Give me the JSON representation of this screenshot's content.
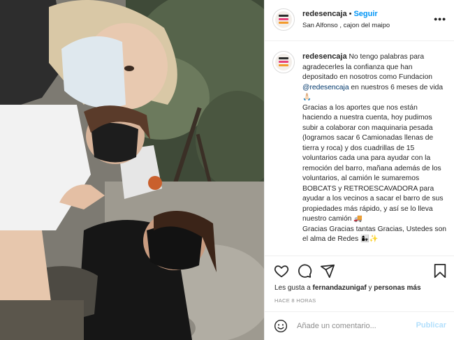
{
  "post": {
    "image_alt": "Three women wearing face masks in a forest",
    "image_icon": "photo-image"
  },
  "header": {
    "username": "redesencaja",
    "separator": "•",
    "follow_label": "Seguir",
    "location": "San Alfonso , cajon del maipo",
    "more_icon": "more-options-icon",
    "more_label": "•••"
  },
  "caption": {
    "username": "redesencaja",
    "text_before_mention": "No tengo palabras para agradecerles la confianza que han depositado en nosotros como Fundacion ",
    "mention": "@redesencaja",
    "text_after_mention": " en nuestros 6 meses de vida 🙏🏻\nGracias a los aportes que nos están haciendo a nuestra cuenta, hoy pudimos subir a colaborar con maquinaria pesada (logramos sacar 6 Camionadas llenas de tierra y roca) y dos cuadrillas de 15 voluntarios cada una para ayudar con la remoción del barro, mañana además de los voluntarios, al camión le sumaremos BOBCATS y RETROESCAVADORA para ayudar a los vecinos a sacar el barro de sus propiedades más rápido, y así se lo lleva nuestro camión 🚚\nGracias Gracias tantas Gracias, Ustedes son el alma de Redes 👩‍👧✨"
  },
  "actions": {
    "like_icon": "heart-icon",
    "comment_icon": "comment-icon",
    "share_icon": "share-icon",
    "save_icon": "bookmark-icon"
  },
  "likes": {
    "prefix": "Les gusta a ",
    "user": "fernandazunigaf",
    "middle": " y ",
    "others": "personas más"
  },
  "time_ago": "HACE 8 HORAS",
  "comment": {
    "emoji_icon": "emoji-icon",
    "placeholder": "Añade un comentario...",
    "value": "",
    "publish_label": "Publicar"
  },
  "colors": {
    "link": "#0095f6",
    "mention": "#00376b",
    "publish_disabled": "#b2dffc",
    "muted": "#8e8e8e",
    "text": "#262626"
  }
}
